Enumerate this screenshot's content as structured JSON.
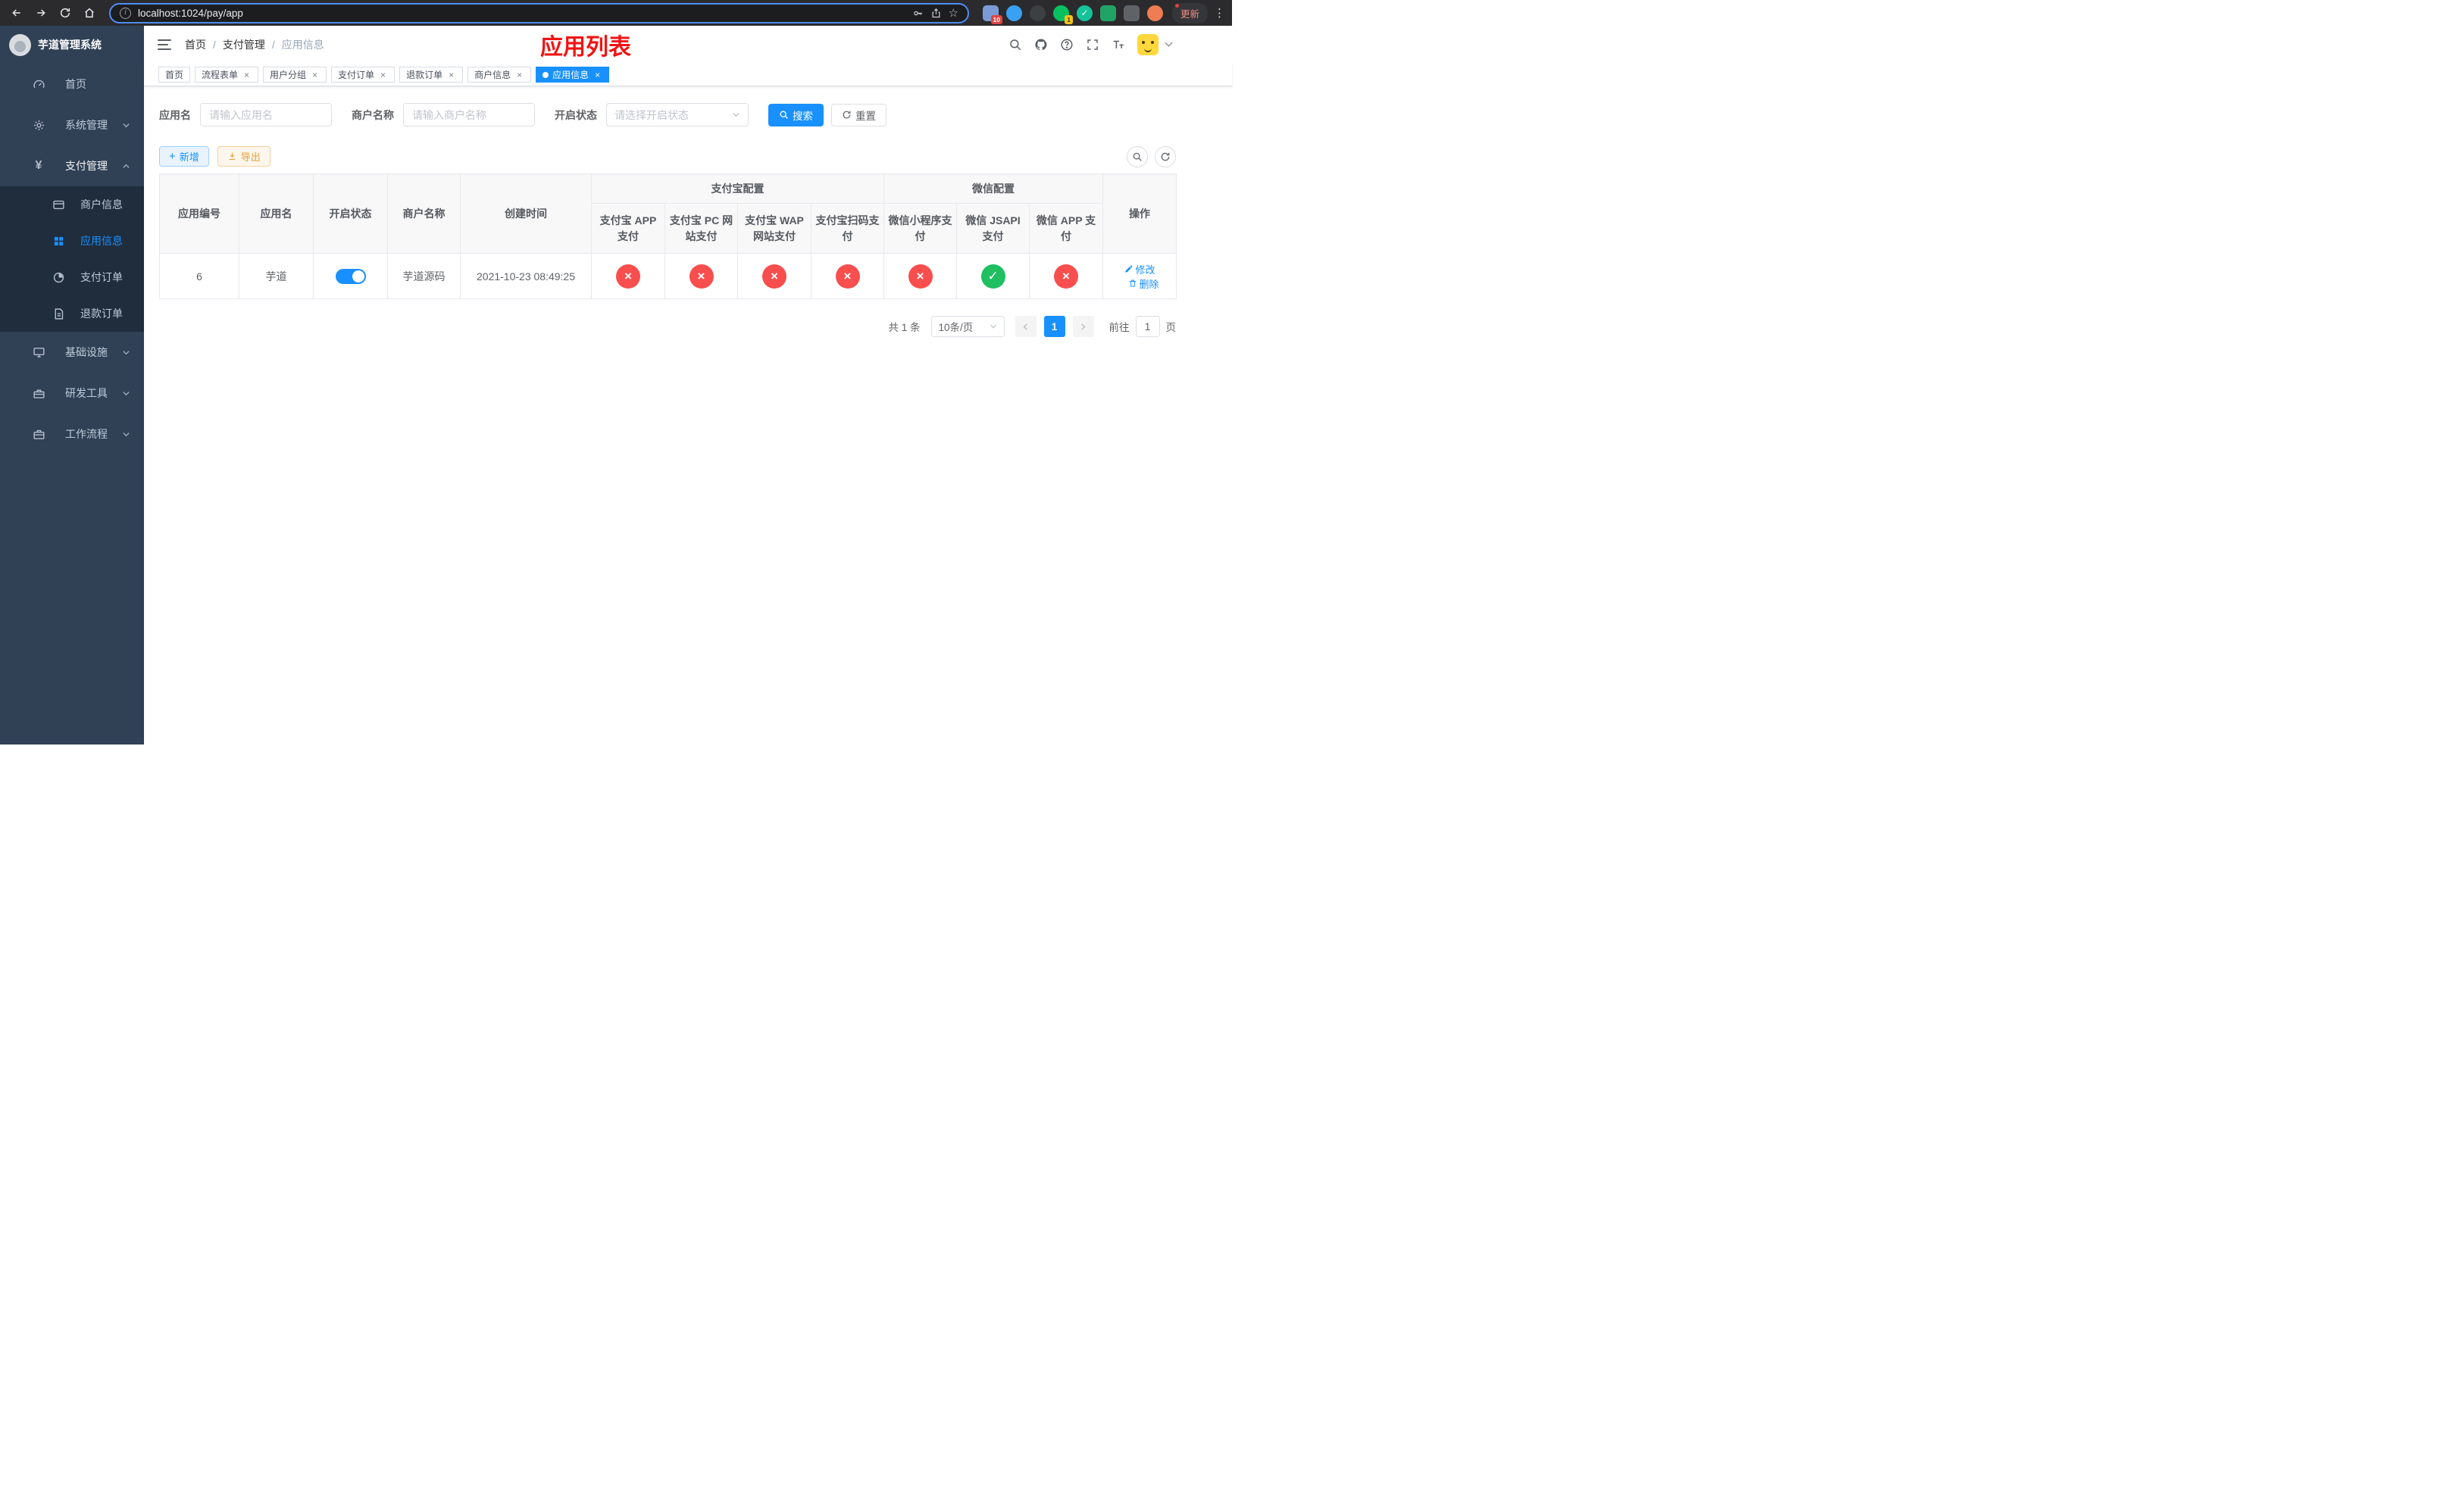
{
  "colors": {
    "accent": "#1890ff",
    "title_red": "#f01414",
    "success_green": "#1fbf62",
    "danger_red": "#f84e4e",
    "sidebar_bg": "#304156",
    "submenu_bg": "#1f2d3d"
  },
  "browser": {
    "url": "localhost:1024/pay/app",
    "update_label": "更新",
    "menu_glyph": "⋮",
    "star_glyph": "☆",
    "ext_badge_puzzle": "10",
    "ext_badge_wechat": "1",
    "ext_check_glyph": "✓"
  },
  "sidebar": {
    "brand": "芋道管理系统",
    "items": [
      {
        "label": "首页"
      },
      {
        "label": "系统管理"
      },
      {
        "label": "支付管理"
      },
      {
        "label": "商户信息"
      },
      {
        "label": "应用信息"
      },
      {
        "label": "支付订单"
      },
      {
        "label": "退款订单"
      },
      {
        "label": "基础设施"
      },
      {
        "label": "研发工具"
      },
      {
        "label": "工作流程"
      }
    ],
    "pay_icon": "¥"
  },
  "header": {
    "breadcrumb": [
      "首页",
      "支付管理",
      "应用信息"
    ],
    "separator": "/",
    "title": "应用列表"
  },
  "tabs": [
    {
      "label": "首页"
    },
    {
      "label": "流程表单"
    },
    {
      "label": "用户分组"
    },
    {
      "label": "支付订单"
    },
    {
      "label": "退款订单"
    },
    {
      "label": "商户信息"
    },
    {
      "label": "应用信息"
    }
  ],
  "tab_close_glyph": "×",
  "filters": {
    "app_name_label": "应用名",
    "app_name_placeholder": "请输入应用名",
    "merchant_label": "商户名称",
    "merchant_placeholder": "请输入商户名称",
    "status_label": "开启状态",
    "status_placeholder": "请选择开启状态",
    "search_label": "搜索",
    "reset_label": "重置"
  },
  "toolbar": {
    "add_label": "新增",
    "add_icon": "+",
    "export_label": "导出"
  },
  "table": {
    "group_alipay": "支付宝配置",
    "group_wechat": "微信配置",
    "col_id": "应用编号",
    "col_name": "应用名",
    "col_status": "开启状态",
    "col_merchant": "商户名称",
    "col_created": "创建时间",
    "col_actions": "操作",
    "sub_columns": [
      "支付宝 APP 支付",
      "支付宝 PC 网站支付",
      "支付宝 WAP 网站支付",
      "支付宝扫码支付",
      "微信小程序支付",
      "微信 JSAPI 支付",
      "微信 APP 支付"
    ],
    "row": {
      "id": "6",
      "name": "芋道",
      "enabled": true,
      "merchant": "芋道源码",
      "created": "2021-10-23 08:49:25",
      "configs": [
        "no",
        "no",
        "no",
        "no",
        "no",
        "yes",
        "no"
      ],
      "edit_label": "修改",
      "delete_label": "删除"
    }
  },
  "icons": {
    "ok": "✓",
    "fail": "×"
  },
  "pagination": {
    "total": "共 1 条",
    "page_size": "10条/页",
    "page": "1",
    "jump_prefix": "前往",
    "jump_value": "1",
    "jump_suffix": "页"
  }
}
